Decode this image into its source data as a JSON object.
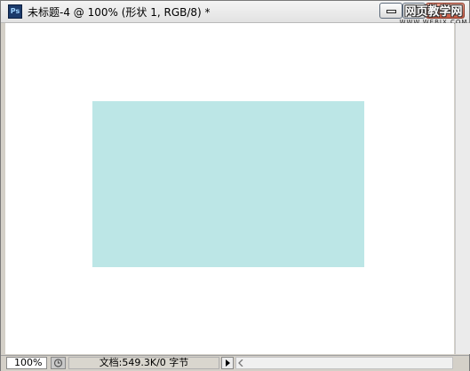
{
  "window": {
    "title": "未标题-4 @ 100% (形状 1, RGB/8) *",
    "app_icon_text": "Ps"
  },
  "watermark": {
    "main": "网页教学网",
    "sub": "WWW.WEBJX.COM"
  },
  "canvas": {
    "background": "#ffffff",
    "shape_color": "#bce6e6"
  },
  "status": {
    "zoom": "100%",
    "doc_info": "文档:549.3K/0 字节"
  },
  "icons": {
    "app": "photoshop-icon",
    "minimize": "minimize-icon",
    "maximize": "maximize-icon",
    "close": "close-icon",
    "status": "history-icon",
    "menu": "triangle-right-icon",
    "scroll_left": "scroll-left-icon"
  }
}
